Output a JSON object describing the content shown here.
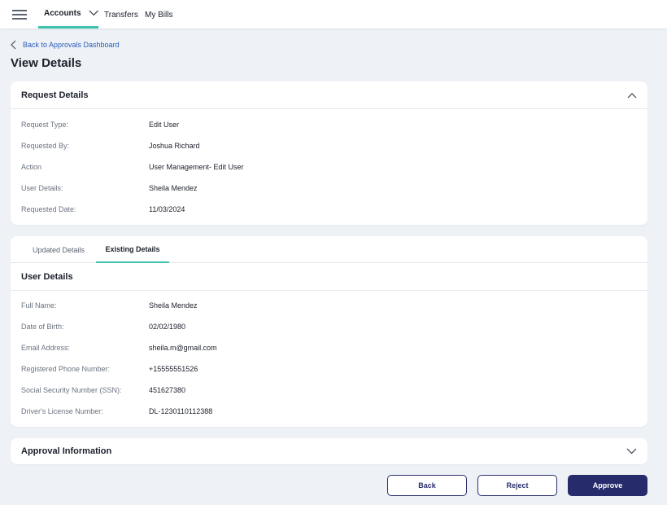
{
  "nav": {
    "menu_icon": "hamburger-menu-icon",
    "accounts": "Accounts",
    "transfers": "Transfers",
    "bills": "My Bills"
  },
  "back_link": "Back to Approvals Dashboard",
  "page_title": "View Details",
  "request_details": {
    "title": "Request Details",
    "rows": [
      {
        "label": "Request Type:",
        "value": "Edit User"
      },
      {
        "label": "Requested By:",
        "value": "Joshua Richard"
      },
      {
        "label": "Action",
        "value": "User Management- Edit User"
      },
      {
        "label": "User Details:",
        "value": "Sheila Mendez"
      },
      {
        "label": "Requested Date:",
        "value": "11/03/2024"
      }
    ]
  },
  "tabs": {
    "updated": "Updated Details",
    "existing": "Existing Details",
    "active": "Existing Details"
  },
  "user_details": {
    "title": "User Details",
    "rows": [
      {
        "label": "Full Name:",
        "value": "Sheila Mendez"
      },
      {
        "label": "Date of Birth:",
        "value": "02/02/1980"
      },
      {
        "label": "Email Address:",
        "value": "sheila.m@gmail.com"
      },
      {
        "label": "Registered Phone Number:",
        "value": "+15555551526"
      },
      {
        "label": "Social Security Number (SSN):",
        "value": "451627380"
      },
      {
        "label": "Driver's License Number:",
        "value": "DL-1230110112388"
      }
    ]
  },
  "approval_info": {
    "title": "Approval Information"
  },
  "buttons": {
    "back": "Back",
    "reject": "Reject",
    "approve": "Approve"
  },
  "colors": {
    "accent": "#3fc1b0",
    "primary": "#262b6b",
    "link": "#2a5bb8",
    "background": "#eef2f6"
  }
}
